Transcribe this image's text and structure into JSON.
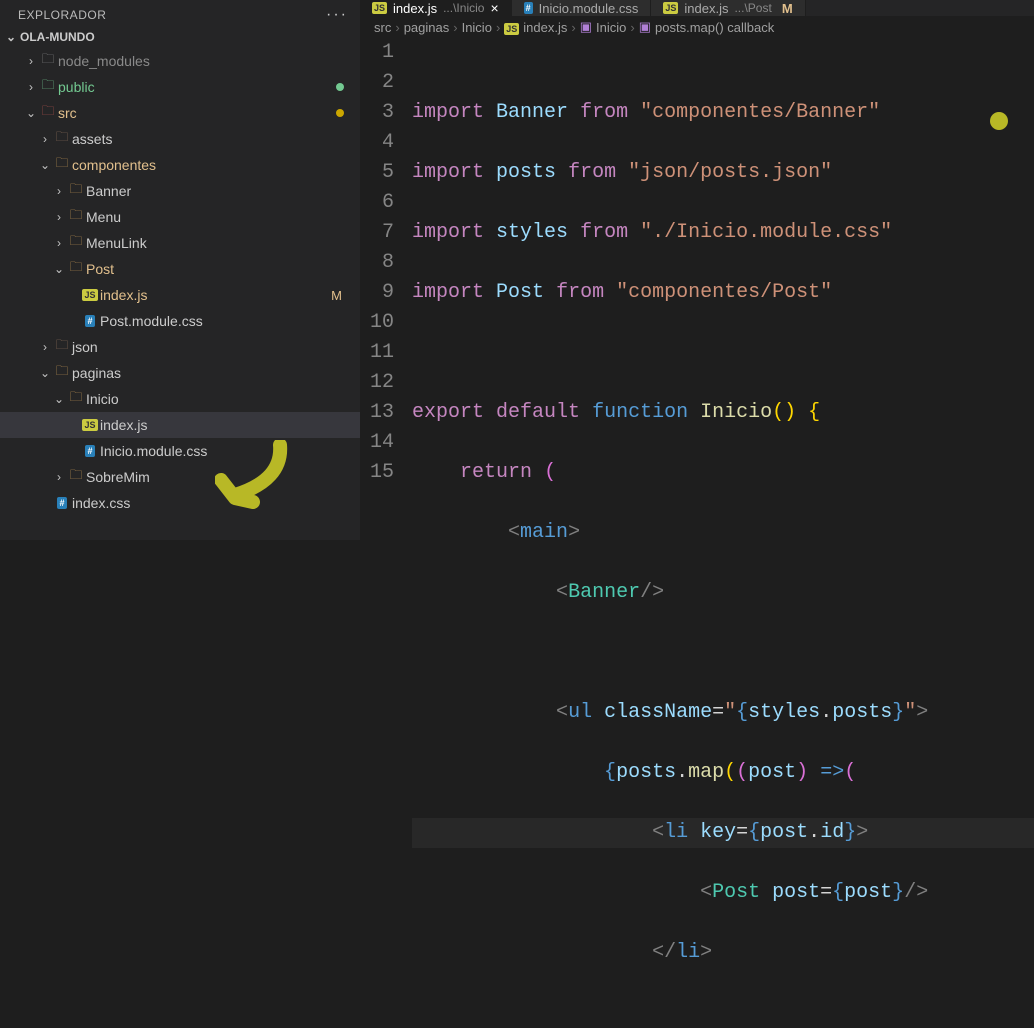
{
  "sidebar": {
    "title": "EXPLORADOR",
    "project": "OLA-MUNDO",
    "items": [
      {
        "label": "node_modules",
        "icon": "folder-dim",
        "chev": "closed",
        "indent": 1,
        "class": "lbl-dim"
      },
      {
        "label": "public",
        "icon": "folder-green",
        "chev": "closed",
        "indent": 1,
        "class": "lbl-green",
        "dot": "green"
      },
      {
        "label": "src",
        "icon": "folder-red",
        "chev": "open",
        "indent": 1,
        "class": "lbl-ylw",
        "dot": "yel"
      },
      {
        "label": "assets",
        "icon": "folder-brown",
        "chev": "closed",
        "indent": 2,
        "class": ""
      },
      {
        "label": "componentes",
        "icon": "folder-open",
        "chev": "open",
        "indent": 2,
        "class": "lbl-ylw"
      },
      {
        "label": "Banner",
        "icon": "folder",
        "chev": "closed",
        "indent": 3,
        "class": ""
      },
      {
        "label": "Menu",
        "icon": "folder",
        "chev": "closed",
        "indent": 3,
        "class": ""
      },
      {
        "label": "MenuLink",
        "icon": "folder",
        "chev": "closed",
        "indent": 3,
        "class": ""
      },
      {
        "label": "Post",
        "icon": "folder-open",
        "chev": "open",
        "indent": 3,
        "class": "lbl-ylw"
      },
      {
        "label": "index.js",
        "icon": "js",
        "chev": "none",
        "indent": 4,
        "class": "lbl-ylw",
        "badge": "M"
      },
      {
        "label": "Post.module.css",
        "icon": "css",
        "chev": "none",
        "indent": 4,
        "class": ""
      },
      {
        "label": "json",
        "icon": "folder-brown",
        "chev": "closed",
        "indent": 2,
        "class": ""
      },
      {
        "label": "paginas",
        "icon": "folder-open",
        "chev": "open",
        "indent": 2,
        "class": ""
      },
      {
        "label": "Inicio",
        "icon": "folder-open",
        "chev": "open",
        "indent": 3,
        "class": ""
      },
      {
        "label": "index.js",
        "icon": "js",
        "chev": "none",
        "indent": 4,
        "class": "",
        "selected": true
      },
      {
        "label": "Inicio.module.css",
        "icon": "css",
        "chev": "none",
        "indent": 4,
        "class": ""
      },
      {
        "label": "SobreMim",
        "icon": "folder",
        "chev": "closed",
        "indent": 3,
        "class": ""
      },
      {
        "label": "index.css",
        "icon": "css",
        "chev": "none",
        "indent": 2,
        "class": ""
      }
    ]
  },
  "tabs": [
    {
      "icon": "js",
      "label": "index.js",
      "sub": "...\\Inicio",
      "active": true,
      "close": "×"
    },
    {
      "icon": "css",
      "label": "Inicio.module.css",
      "active": false
    },
    {
      "icon": "js",
      "label": "index.js",
      "sub": "...\\Post",
      "active": false,
      "mod": "M"
    }
  ],
  "breadcrumbs": [
    "src",
    "paginas",
    "Inicio",
    "index.js",
    "Inicio",
    "posts.map() callback"
  ],
  "bc_icons": [
    "",
    "",
    "",
    "js",
    "cube",
    "cube"
  ],
  "code": {
    "lines": [
      1,
      2,
      3,
      4,
      5,
      6,
      7,
      8,
      9,
      10,
      11,
      12,
      13,
      14,
      15
    ]
  }
}
